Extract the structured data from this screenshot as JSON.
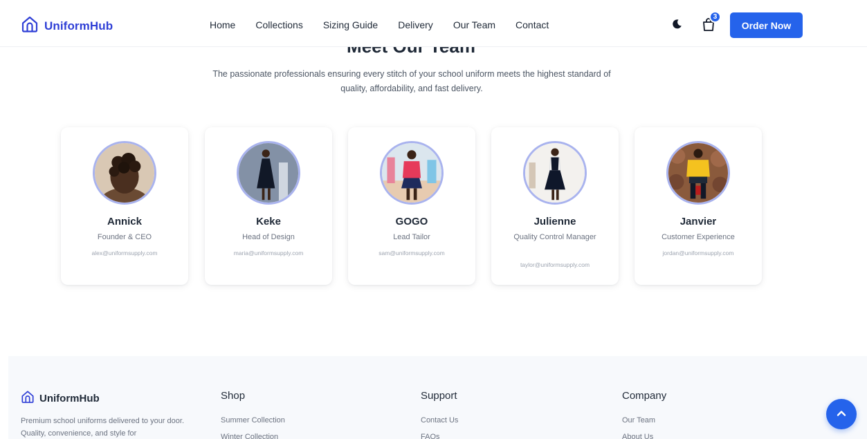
{
  "header": {
    "brand": "UniformHub",
    "nav": [
      "Home",
      "Collections",
      "Sizing Guide",
      "Delivery",
      "Our Team",
      "Contact"
    ],
    "cart_count": "3",
    "order_button": "Order Now"
  },
  "team": {
    "title": "Meet Our Team",
    "subtitle": "The passionate professionals ensuring every stitch of your school uniform meets the highest standard of quality, affordability, and fast delivery.",
    "members": [
      {
        "name": "Annick",
        "role": "Founder & CEO",
        "email": "alex@uniformsupply.com"
      },
      {
        "name": "Keke",
        "role": "Head of Design",
        "email": "maria@uniformsupply.com"
      },
      {
        "name": "GOGO",
        "role": "Lead Tailor",
        "email": "sam@uniformsupply.com"
      },
      {
        "name": "Julienne",
        "role": "Quality Control Manager",
        "email": "taylor@uniformsupply.com"
      },
      {
        "name": "Janvier",
        "role": "Customer Experience",
        "email": "jordan@uniformsupply.com"
      }
    ]
  },
  "footer": {
    "brand": "UniformHub",
    "description": "Premium school uniforms delivered to your door. Quality, convenience, and style for",
    "columns": [
      {
        "title": "Shop",
        "links": [
          "Summer Collection",
          "Winter Collection"
        ]
      },
      {
        "title": "Support",
        "links": [
          "Contact Us",
          "FAQs"
        ]
      },
      {
        "title": "Company",
        "links": [
          "Our Team",
          "About Us"
        ]
      }
    ]
  },
  "colors": {
    "primary": "#2563eb",
    "brand_text": "#2f3fd6",
    "avatar_ring": "#a9b3ee",
    "footer_bg": "#f7f9fc"
  },
  "icons": {
    "brand": "home-outline-icon",
    "theme_toggle": "moon-icon",
    "cart": "shopping-bag-icon",
    "scroll_top": "chevron-up-icon"
  }
}
